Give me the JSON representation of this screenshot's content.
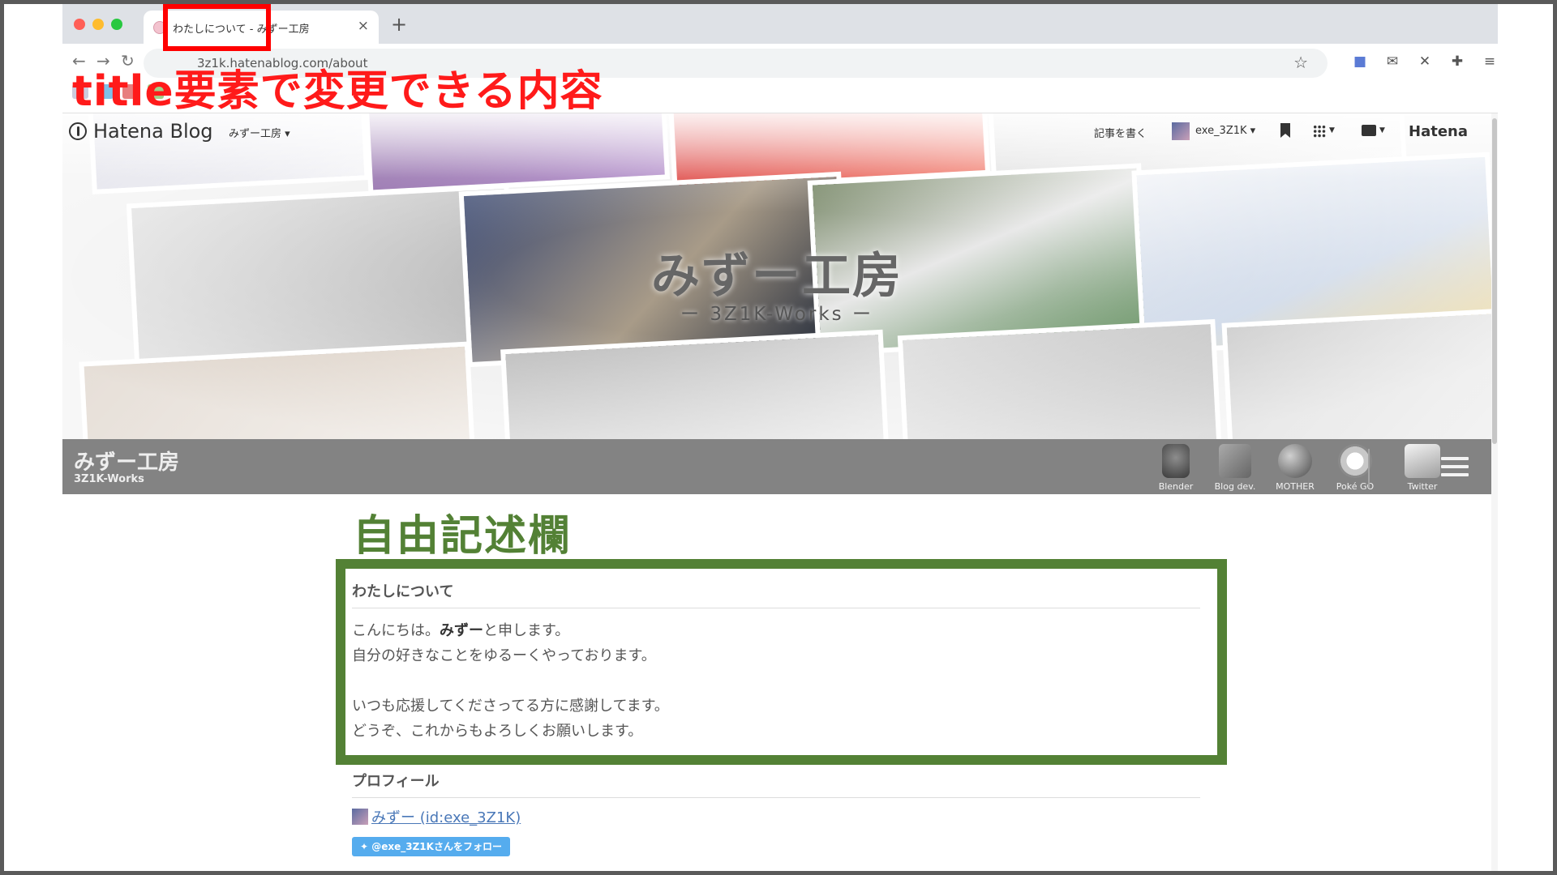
{
  "browser": {
    "tab_title": "わたしについて - みずー工房",
    "url": "3z1k.hatenablog.com/about"
  },
  "hatena_bar": {
    "logo": "Hatena Blog",
    "blog_menu": "みずー工房 ▾",
    "write": "記事を書く",
    "user": "exe_3Z1K ▾",
    "hatena": "Hatena"
  },
  "header": {
    "title": "みずー工房",
    "subtitle": "ー 3Z1K-Works ー"
  },
  "blog_nav": {
    "title": "みずー工房",
    "subtitle": "3Z1K-Works",
    "links": [
      {
        "label": "Blender"
      },
      {
        "label": "Blog dev."
      },
      {
        "label": "MOTHER"
      },
      {
        "label": "Poké GO"
      },
      {
        "label": "Twitter"
      }
    ]
  },
  "about": {
    "title": "わたしについて",
    "line1_pre": "こんにちは。",
    "line1_bold": "みずー",
    "line1_post": "と申します。",
    "line2": "自分の好きなことをゆるーくやっております。",
    "line3": "いつも応援してくださってる方に感謝してます。",
    "line4": "どうぞ、これからもよろしくお願いします。"
  },
  "profile": {
    "title": "プロフィール",
    "link": "みずー (id:exe_3Z1K)",
    "follow": "@exe_3Z1Kさんをフォロー"
  },
  "annotations": {
    "red_label": "title要素で変更できる内容",
    "green_label": "自由記述欄",
    "red_color": "#ff0000",
    "green_color": "#538135"
  }
}
